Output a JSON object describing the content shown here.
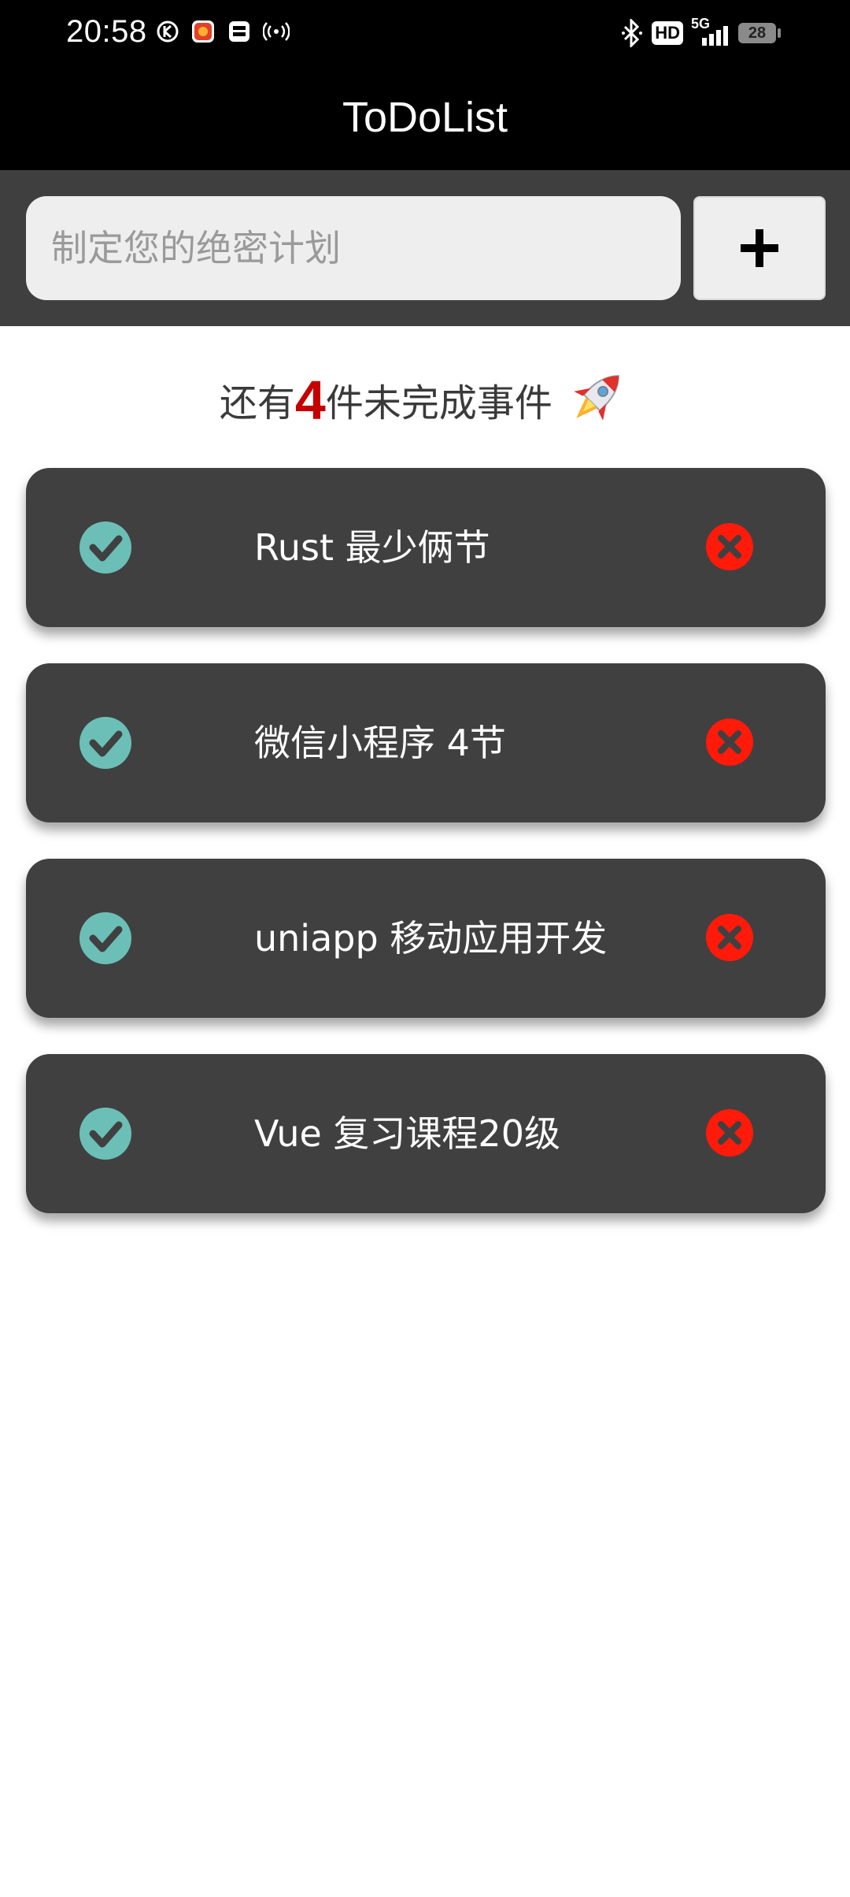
{
  "status_bar": {
    "time": "20:58",
    "network": "5G",
    "hd": "HD",
    "battery": "28"
  },
  "app": {
    "title": "ToDoList"
  },
  "input": {
    "placeholder": "制定您的绝密计划",
    "value": ""
  },
  "add_button": {
    "icon": "plus-icon"
  },
  "summary": {
    "prefix": "还有",
    "count": "4",
    "suffix": "件未完成事件",
    "icon": "rocket-icon"
  },
  "tasks": [
    {
      "text": "Rust 最少俩节"
    },
    {
      "text": "微信小程序 4节"
    },
    {
      "text": "uniapp 移动应用开发"
    },
    {
      "text": "Vue 复习课程20级"
    }
  ],
  "colors": {
    "check": "#6cbfb6",
    "delete": "#ff1a0a",
    "card": "#404040",
    "count": "#c40000",
    "panel": "#3f3f3f"
  }
}
